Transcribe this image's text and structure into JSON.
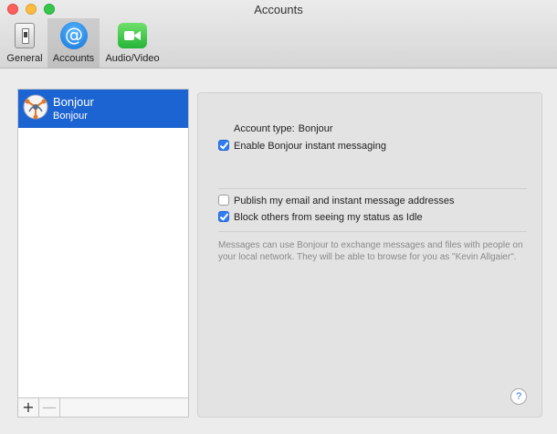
{
  "window": {
    "title": "Accounts"
  },
  "toolbar": {
    "items": [
      {
        "label": "General",
        "icon": "general-switch-icon",
        "selected": false
      },
      {
        "label": "Accounts",
        "icon": "at-sign-icon",
        "selected": true
      },
      {
        "label": "Audio/Video",
        "icon": "video-camera-icon",
        "selected": false
      }
    ]
  },
  "accounts_list": {
    "items": [
      {
        "name": "Bonjour",
        "subtitle": "Bonjour",
        "icon": "bonjour-icon",
        "selected": true
      }
    ],
    "add_label": "+",
    "remove_label": "—"
  },
  "detail": {
    "account_type_label": "Account type:",
    "account_type_value": "Bonjour",
    "enable_label": "Enable Bonjour instant messaging",
    "enable_checked": true,
    "publish_label": "Publish my email and instant message addresses",
    "publish_checked": false,
    "block_label": "Block others from seeing my status as Idle",
    "block_checked": true,
    "info_text": "Messages can use Bonjour to exchange messages and files with people on your local network. They will be able to browse for you as \"Kevin Allgaier\".",
    "help_label": "?"
  },
  "colors": {
    "selection": "#1c64d1",
    "checkbox": "#2f7cf6"
  }
}
